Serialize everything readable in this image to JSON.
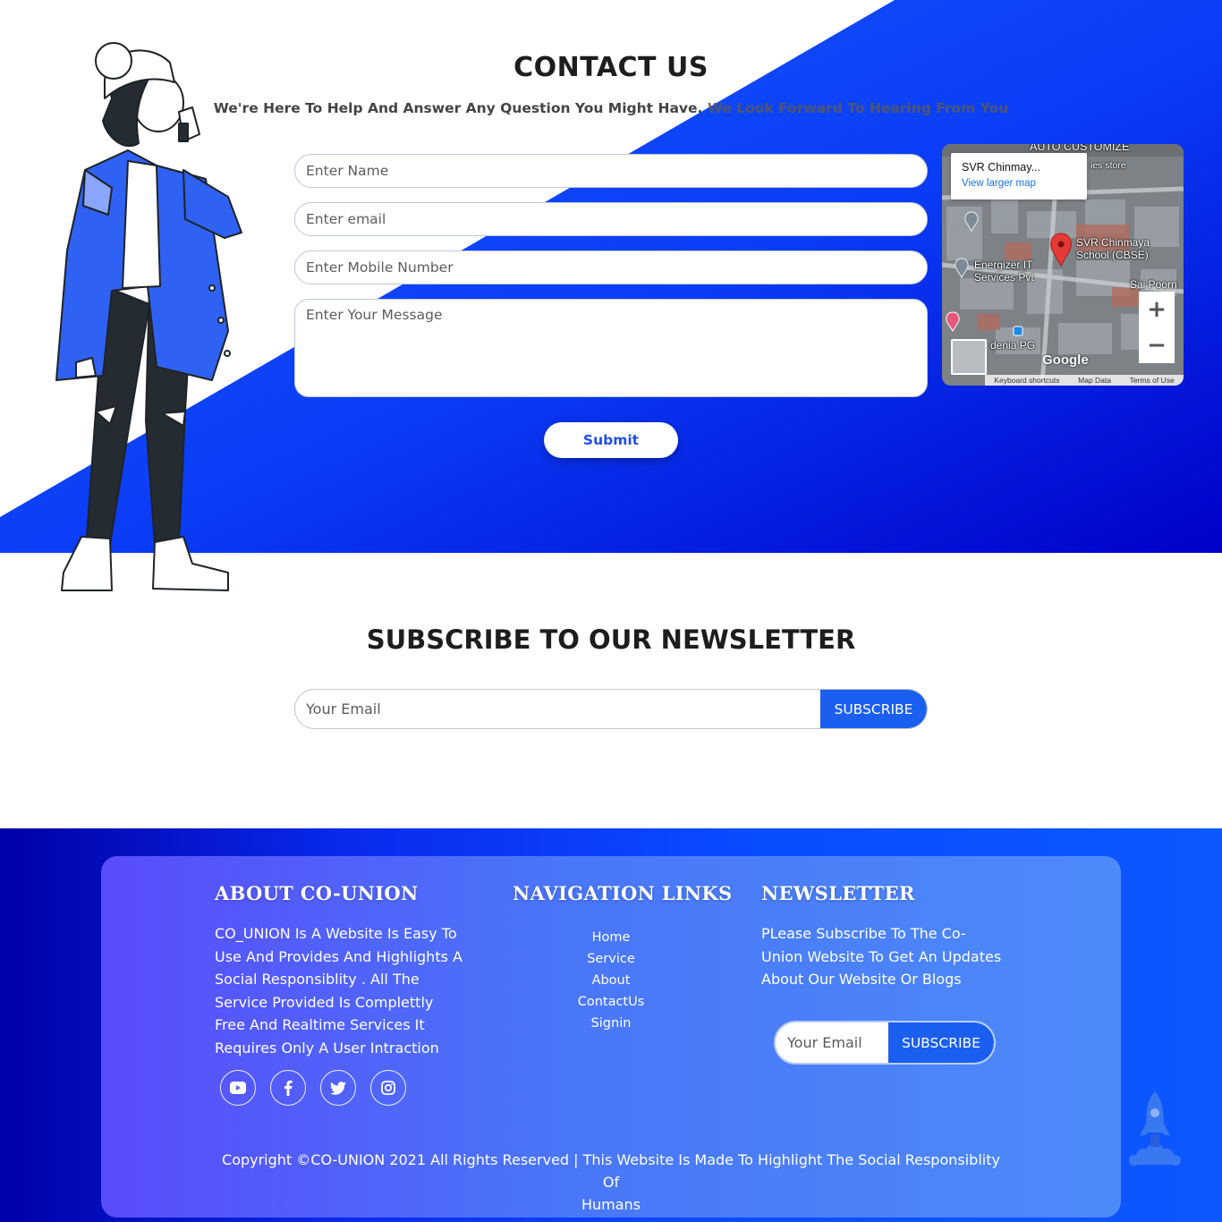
{
  "contact": {
    "title": "CONTACT US",
    "subtitle_part1": "We're Here To Help And Answer Any Question You Might Have.",
    "subtitle_part2": " We Look Forward To Hearing From You",
    "name_placeholder": "Enter Name",
    "email_placeholder": "Enter email",
    "mobile_placeholder": "Enter Mobile Number",
    "message_placeholder": "Enter Your Message",
    "submit_label": "Submit",
    "colors": {
      "accent": "#0a2cf0",
      "gradient_end": "#0000cc"
    }
  },
  "map": {
    "place_title": "SVR Chinmay...",
    "larger_map_link": "View larger map",
    "top_label": "AUTO CUSTOMIZE",
    "store_label": "ies store",
    "school_label_1": "SVR Chinmaya",
    "school_label_2": "School (CBSE)",
    "energizer_label_1": "Energizer IT",
    "energizer_label_2": "Services Pvt",
    "sai_label": "Sai Poorn",
    "pg_label": "denia PG",
    "brand": "Google",
    "footer_shortcuts": "Keyboard shortcuts",
    "footer_data": "Map Data",
    "footer_terms": "Terms of Use",
    "zoom_in": "+",
    "zoom_out": "−"
  },
  "newsletter": {
    "title": "SUBSCRIBE TO OUR NEWSLETTER",
    "email_placeholder": "Your Email",
    "subscribe_label": "SUBSCRIBE"
  },
  "footer": {
    "about_heading": "ABOUT CO-UNION",
    "about_lines": [
      "CO_UNION Is A Website Is Easy To",
      "Use And Provides And Highlights A",
      "Social Responsiblity . All The",
      "Service Provided Is Complettly",
      "Free And Realtime Services It",
      "Requires Only A User Intraction"
    ],
    "nav_heading": "NAVIGATION LINKS",
    "nav_links": [
      "Home",
      "Service",
      "About",
      "ContactUs",
      "Signin"
    ],
    "news_heading": "NEWSLETTER",
    "news_lines": [
      "PLease Subscribe To The Co-",
      "Union Website To Get An Updates",
      "About Our Website Or Blogs"
    ],
    "news_placeholder": "Your Email",
    "news_subscribe": "SUBSCRIBE",
    "social_icons": [
      "youtube-icon",
      "facebook-icon",
      "twitter-icon",
      "instagram-icon"
    ],
    "copyright_line1": "Copyright ©CO-UNION 2021 All Rights Reserved | This Website Is Made To Highlight The Social Responsiblity Of",
    "copyright_line2": "Humans"
  }
}
